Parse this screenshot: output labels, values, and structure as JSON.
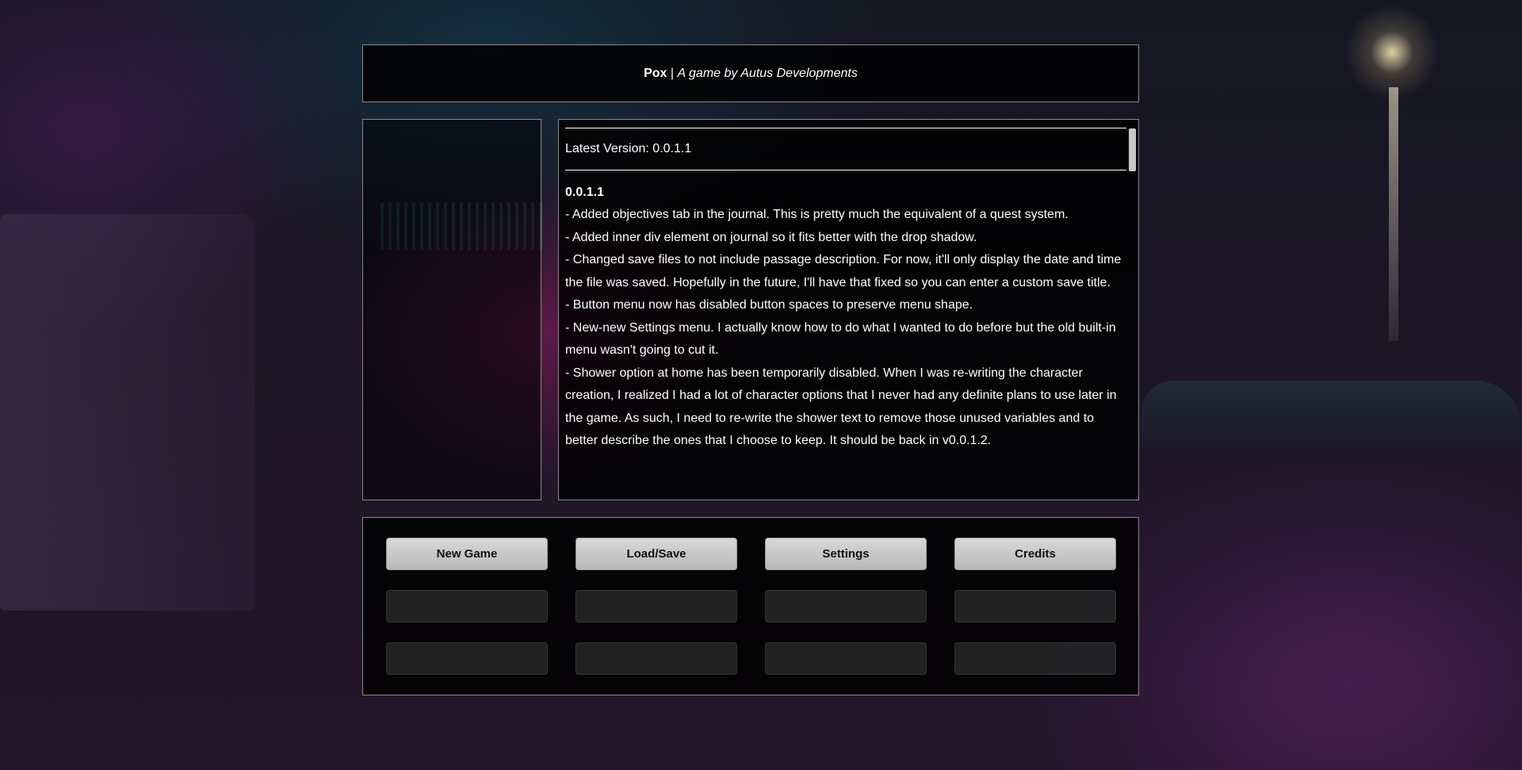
{
  "header": {
    "game_name": "Pox",
    "separator": " | ",
    "tagline": "A game by Autus Developments"
  },
  "changelog": {
    "latest_version_text": "Latest Version: 0.0.1.1",
    "entries": [
      {
        "version": "0.0.1.1",
        "lines": [
          "- Added objectives tab in the journal. This is pretty much the equivalent of a quest system.",
          "- Added inner div element on journal so it fits better with the drop shadow.",
          "- Changed save files to not include passage description. For now, it'll only display the date and time the file was saved. Hopefully in the future, I'll have that fixed so you can enter a custom save title.",
          "- Button menu now has disabled button spaces to preserve menu shape.",
          "- New-new Settings menu. I actually know how to do what I wanted to do before but the old built-in menu wasn't going to cut it.",
          "- Shower option at home has been temporarily disabled. When I was re-writing the character creation, I realized I had a lot of character options that I never had any definite plans to use later in the game. As such, I need to re-write the shower text to remove those unused variables and to better describe the ones that I choose to keep. It should be back in v0.0.1.2."
        ]
      }
    ]
  },
  "menu": {
    "buttons": [
      "New Game",
      "Load/Save",
      "Settings",
      "Credits"
    ],
    "disabled_slots": 8
  }
}
